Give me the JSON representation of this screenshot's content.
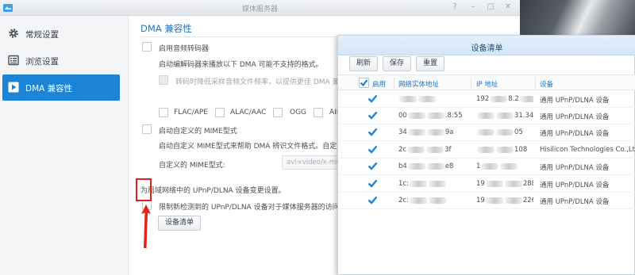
{
  "window": {
    "title": "媒体服务器",
    "help": "?",
    "minimize": "–",
    "maximize": "□",
    "close": "✕"
  },
  "sidebar": {
    "items": [
      {
        "label": "常规设置",
        "icon": "gear-icon",
        "active": false
      },
      {
        "label": "浏览设置",
        "icon": "browse-list-icon",
        "active": false
      },
      {
        "label": "DMA 兼容性",
        "icon": "play-icon",
        "active": true
      }
    ]
  },
  "main": {
    "section_title": "DMA 兼容性",
    "enable_transcoder": "启用音频转码器",
    "transcoder_desc": "启动编解码器来播放以下 DMA 可能不支持的格式。",
    "resample_label": "转码时降低采样音频文件频率，以提供更佳 DMA 兼容性",
    "formats": [
      "FLAC/APE",
      "ALAC/AAC",
      "OGG",
      "AIFF"
    ],
    "enable_mime": "启动自定义的 MIME型式",
    "mime_desc": "启动自定义 MIME型式来帮助 DMA 辨识文件格式。自定义的",
    "mime_label": "自定义的 MIME型式:",
    "mime_value": "avi=video/x-msvideo",
    "upnp_desc": "为局域网络中的 UPnP/DLNA 设备变更设置。",
    "restrict_label": "限制新检测到的 UPnP/DLNA 设备对于媒体服务器的访问",
    "device_list_button": "设备清单"
  },
  "dialog": {
    "title": "设备清单",
    "buttons": {
      "refresh": "刷新",
      "save": "保存",
      "reset": "重置"
    },
    "columns": {
      "enable": "启用",
      "mac": "网络实体地址",
      "ip": "IP 地址",
      "device": "设备"
    },
    "rows": [
      {
        "enabled": true,
        "mac_start": "",
        "mac_end": "",
        "ip_start": "192",
        "ip_mid": "8.2",
        "ip_end": "06",
        "device": "通用 UPnP/DLNA 设备"
      },
      {
        "enabled": true,
        "mac_start": "00",
        "mac_end": ".8:55",
        "ip_start": "",
        "ip_mid": "",
        "ip_end": "31.34",
        "device": "通用 UPnP/DLNA 设备"
      },
      {
        "enabled": true,
        "mac_start": "34",
        "mac_end": "9a",
        "ip_start": "",
        "ip_mid": "",
        "ip_end": "05",
        "device": "通用 UPnP/DLNA 设备"
      },
      {
        "enabled": true,
        "mac_start": "2c",
        "mac_end": "3f",
        "ip_start": "",
        "ip_mid": "",
        "ip_end": "108",
        "device": "Hisilicon Technologies Co.,Ltd"
      },
      {
        "enabled": true,
        "mac_start": "b4",
        "mac_end": "e8",
        "ip_start": "1",
        "ip_mid": "",
        "ip_end": "",
        "device": "通用 UPnP/DLNA 设备"
      },
      {
        "enabled": true,
        "mac_start": "1c:",
        "mac_end": "",
        "ip_start": "19",
        "ip_mid": "",
        "ip_end": "288",
        "device": "通用 UPnP/DLNA 设备"
      },
      {
        "enabled": true,
        "mac_start": "2c:",
        "mac_end": "",
        "ip_start": "19",
        "ip_mid": "",
        "ip_end": "226",
        "device": "通用 UPnP/DLNA 设备"
      }
    ]
  },
  "colors": {
    "accent": "#1b84d6",
    "highlight_annotation": "#e0221b",
    "heading_blue": "#1e72c7"
  }
}
